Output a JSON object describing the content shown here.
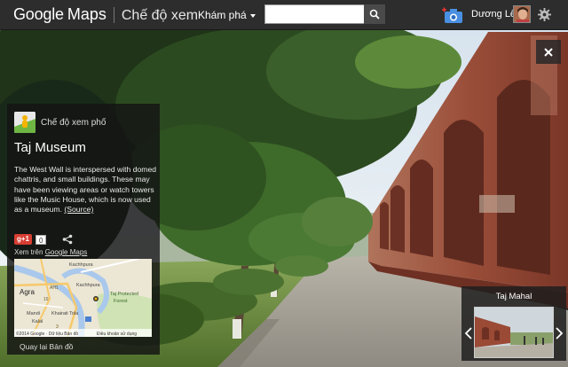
{
  "topbar": {
    "brand_google": "Google",
    "brand_maps": "Maps",
    "mode": "Chế độ xem",
    "explore_label": "Khám phá",
    "search_value": "",
    "search_placeholder": "",
    "user_name": "Dương Lê"
  },
  "panel": {
    "mode_label": "Chế độ xem phố",
    "place_title": "Taj Museum",
    "description": "The West Wall is interspersed with domed chattris, and small buildings. These may have been viewing areas or watch towers like the Music House, which is now used as a museum.",
    "source_label": "(Source)",
    "gplus_label": "g+1",
    "gplus_count": "0",
    "view_on_prefix": "Xem trên",
    "view_on_link": "Google Maps",
    "back_to_map": "Quay lại Bản đồ"
  },
  "minimap": {
    "labels": {
      "kachhpura_top": "Kachhpura",
      "agra": "Agra",
      "kachhpura": "Kachhpura",
      "taj_forest_1": "Taj Protected",
      "taj_forest_2": "Forest",
      "mandi": "Mandi",
      "khairati": "Khairati Tola",
      "kalal": "Kalal",
      "route_ah1": "AH1",
      "route_19": "19",
      "route_3": "3"
    },
    "copyright": "©2014 Google · Dữ liệu Bản đồ",
    "terms": "Điều khoản sử dụng"
  },
  "nearby": {
    "title": "Taj Mahal"
  },
  "icons": {
    "search": "search-icon",
    "camera": "camera-add-icon",
    "settings": "gear-icon",
    "close": "close-icon",
    "share": "share-icon",
    "prev": "chevron-left-icon",
    "next": "chevron-right-icon",
    "street_view": "pegman-icon"
  },
  "colors": {
    "topbar_bg": "#2d2d2d",
    "panel_bg": "#141414",
    "gplus_red": "#d73d32",
    "camera_blue": "#4a90e2",
    "wall_red": "#9a4a35"
  }
}
